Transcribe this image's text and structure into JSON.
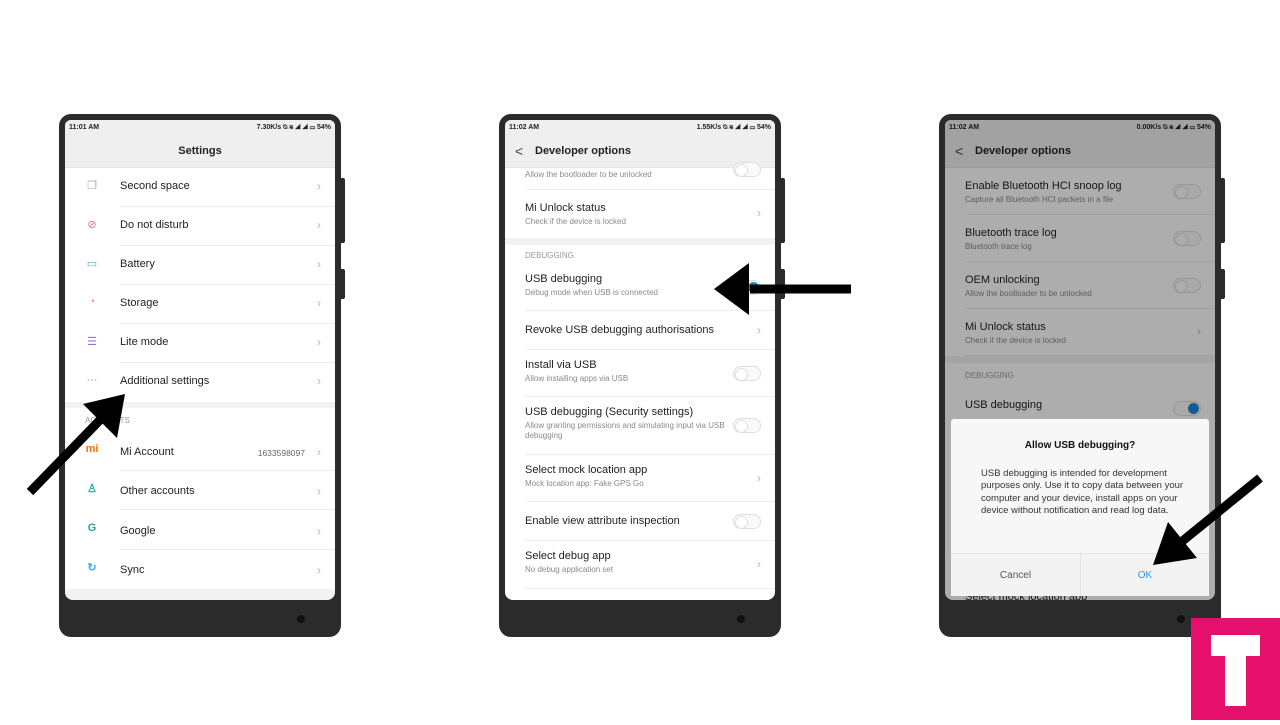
{
  "phone1": {
    "status": {
      "time": "11:01 AM",
      "right": "7.30K/s ⍉ ≋ ◢ ◢ ▭ 54%"
    },
    "header": {
      "title": "Settings"
    },
    "items": [
      {
        "label": "Second space",
        "icon": "second-space-icon",
        "glyph": "❐",
        "color": "#b39ddb"
      },
      {
        "label": "Do not disturb",
        "icon": "do-not-disturb-icon",
        "glyph": "⊘",
        "color": "#e57373"
      },
      {
        "label": "Battery",
        "icon": "battery-icon",
        "glyph": "▭",
        "color": "#4db6ac"
      },
      {
        "label": "Storage",
        "icon": "storage-icon",
        "glyph": "◔",
        "color": "#ff8a65"
      },
      {
        "label": "Lite mode",
        "icon": "lite-mode-icon",
        "glyph": "☰",
        "color": "#9575cd"
      },
      {
        "label": "Additional settings",
        "icon": "more-dots-icon",
        "glyph": "···",
        "color": "#42a5f5"
      }
    ],
    "section": "ACCOUNTS",
    "accounts": [
      {
        "label": "Mi Account",
        "value": "1633598097",
        "icon": "mi-logo-icon",
        "glyph": "mi",
        "color": "#ff6f00"
      },
      {
        "label": "Other accounts",
        "icon": "person-icon",
        "glyph": "♙",
        "color": "#26a69a"
      },
      {
        "label": "Google",
        "icon": "google-icon",
        "glyph": "G",
        "color": "#26a69a"
      },
      {
        "label": "Sync",
        "icon": "sync-icon",
        "glyph": "↻",
        "color": "#42a5f5"
      }
    ]
  },
  "phone2": {
    "status": {
      "time": "11:02 AM",
      "right": "1.55K/s ⍉ ≋ ◢ ◢ ▭ 54%"
    },
    "header": {
      "title": "Developer options",
      "back": "<"
    },
    "top_sub": "Allow the bootloader to be unlocked",
    "mi_unlock": {
      "label": "Mi Unlock status",
      "sub": "Check if the device is locked"
    },
    "section": "DEBUGGING",
    "items": [
      {
        "label": "USB debugging",
        "sub": "Debug mode when USB is connected",
        "control": "toggle",
        "on": true
      },
      {
        "label": "Revoke USB debugging authorisations",
        "control": "chevron"
      },
      {
        "label": "Install via USB",
        "sub": "Allow installing apps via USB",
        "control": "toggle",
        "on": false
      },
      {
        "label": "USB debugging (Security settings)",
        "sub": "Allow granting permissions and simulating input via USB debugging",
        "control": "toggle",
        "on": false
      },
      {
        "label": "Select mock location app",
        "sub": "Mock location app: Fake GPS Go",
        "control": "chevron"
      },
      {
        "label": "Enable view attribute inspection",
        "control": "toggle",
        "on": false
      },
      {
        "label": "Select debug app",
        "sub": "No debug application set",
        "control": "chevron"
      }
    ]
  },
  "phone3": {
    "status": {
      "time": "11:02 AM",
      "right": "0.00K/s ⍉ ≋ ◢ ◢ ▭ 54%"
    },
    "header": {
      "title": "Developer options",
      "back": "<"
    },
    "items": [
      {
        "label": "Enable Bluetooth HCI snoop log",
        "sub": "Capture all Bluetooth HCI packets in a file",
        "control": "toggle",
        "on": false
      },
      {
        "label": "Bluetooth trace log",
        "sub": "Bluetooth trace log",
        "control": "toggle",
        "on": false
      },
      {
        "label": "OEM unlocking",
        "sub": "Allow the bootloader to be unlocked",
        "control": "toggle",
        "on": false
      },
      {
        "label": "Mi Unlock status",
        "sub": "Check if the device is locked",
        "control": "chevron"
      }
    ],
    "section": "DEBUGGING",
    "usb": {
      "label": "USB debugging",
      "control": "toggle",
      "on": true
    },
    "behind": "Select mock location app",
    "dialog": {
      "title": "Allow USB debugging?",
      "body": "USB debugging is intended for development purposes only. Use it to copy data between your computer and your device, install apps on your device without notification and read log data.",
      "cancel": "Cancel",
      "ok": "OK"
    }
  },
  "colors": {
    "accent": "#1e88d6",
    "ok_text": "#1e9be9",
    "logo": "#e5106b"
  },
  "logo": {
    "letter": "T"
  }
}
